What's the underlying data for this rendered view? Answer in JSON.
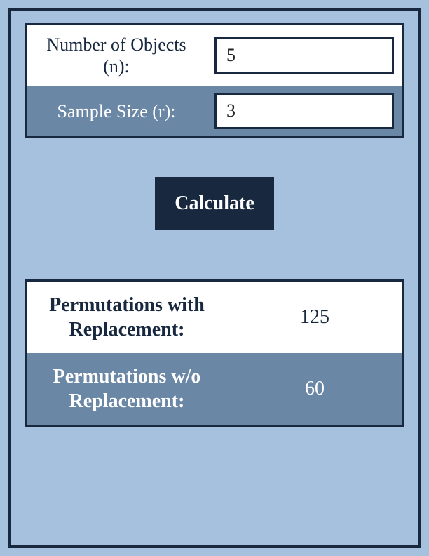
{
  "inputs": {
    "n_label": "Number of Objects (n):",
    "n_value": "5",
    "r_label": "Sample Size (r):",
    "r_value": "3"
  },
  "button": {
    "calculate_label": "Calculate"
  },
  "results": {
    "with_replacement_label": "Permutations with Replacement:",
    "with_replacement_value": "125",
    "without_replacement_label": "Permutations w/o Replacement:",
    "without_replacement_value": "60"
  }
}
